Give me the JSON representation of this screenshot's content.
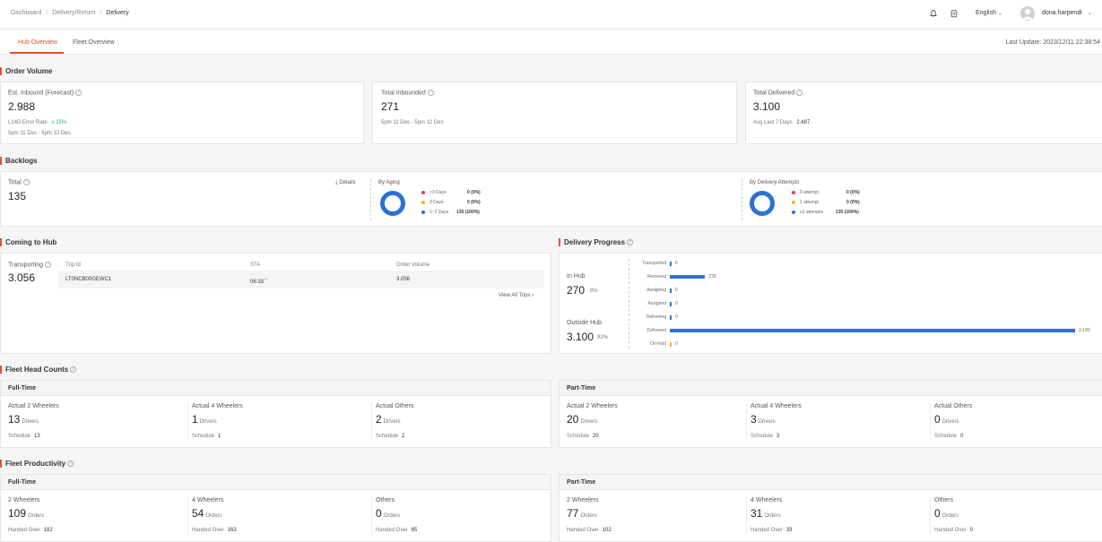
{
  "breadcrumb": {
    "items": [
      "Dashboard",
      "Delivery/Return",
      "Delivery"
    ]
  },
  "header": {
    "language": "English",
    "username": "dona.harpendi"
  },
  "tabs": [
    {
      "label": "Hub Overview",
      "active": true
    },
    {
      "label": "Fleet Overview",
      "active": false
    }
  ],
  "last_update": "Last Update: 2023/12/11 22:38:54",
  "order_volume": {
    "title": "Order Volume",
    "inbound_forecast": {
      "label": "Est. Inbound (Forecast)",
      "value": "2.988",
      "error_label": "L14D Error Rate",
      "error_value": "≤ 15%",
      "range": "5pm 11 Des - 5pm 12 Des"
    },
    "total_inbounded": {
      "label": "Total Inbounded",
      "value": "271",
      "range": "5pm 11 Des - 5pm 12 Des"
    },
    "total_delivered": {
      "label": "Total Delivered",
      "value": "3.100",
      "avg_label": "Avg Last 7 Days",
      "avg_value": "2.487"
    }
  },
  "backlogs": {
    "title": "Backlogs",
    "total_label": "Total",
    "total_value": "135",
    "details_label": "Details",
    "aging": {
      "title": "By Aging",
      "items": [
        {
          "label": ">3 Days",
          "value": "0 (0%)",
          "color": "#e8384f"
        },
        {
          "label": "3 Days",
          "value": "0 (0%)",
          "color": "#f5b31a"
        },
        {
          "label": "1~2 Days",
          "value": "135 (100%)",
          "color": "#2b72d6"
        }
      ]
    },
    "attempts": {
      "title": "By Delivery Attempts",
      "items": [
        {
          "label": "0 attempt",
          "value": "0 (0%)",
          "color": "#e8384f"
        },
        {
          "label": "1 attempt",
          "value": "0 (0%)",
          "color": "#f5b31a"
        },
        {
          "label": "≥2 attempts",
          "value": "135 (100%)",
          "color": "#2b72d6"
        }
      ]
    }
  },
  "coming_to_hub": {
    "title": "Coming to Hub",
    "transporting_label": "Transporting",
    "transporting_value": "3.056",
    "columns": [
      "Trip Id",
      "STA",
      "Order Volume"
    ],
    "row": {
      "trip_id": "LT0NCB00GEWC1",
      "sta": "06:33",
      "sta_suffix": "+1",
      "volume": "3.056"
    },
    "view_all": "View All Trips"
  },
  "delivery_progress": {
    "title": "Delivery Progress",
    "in_hub_label": "In Hub",
    "in_hub_value": "270",
    "in_hub_pct": "8%",
    "outside_hub_label": "Outside Hub",
    "outside_hub_value": "3.100",
    "outside_hub_pct": "92%",
    "stages": [
      {
        "label": "Transported",
        "value": "0",
        "fraction": 0,
        "color": "#2b72d6"
      },
      {
        "label": "Received",
        "value": "270",
        "fraction": 0.087,
        "color": "#2b72d6"
      },
      {
        "label": "Assigning",
        "value": "0",
        "fraction": 0,
        "color": "#2b72d6"
      },
      {
        "label": "Assigned",
        "value": "0",
        "fraction": 0,
        "color": "#2b72d6"
      },
      {
        "label": "Delivering",
        "value": "0",
        "fraction": 0,
        "color": "#2b72d6"
      },
      {
        "label": "Delivered",
        "value": "3.100",
        "fraction": 1,
        "color": "#2b72d6"
      },
      {
        "label": "On-hold",
        "value": "0",
        "fraction": 0,
        "color": "#f5b31a"
      }
    ]
  },
  "fleet_head_counts": {
    "title": "Fleet Head Counts",
    "groups": [
      {
        "name": "Full-Time",
        "items": [
          {
            "label": "Actual 2 Wheelers",
            "value": "13",
            "unit": "Drivers",
            "sub_label": "Schedule",
            "sub_value": "13"
          },
          {
            "label": "Actual 4 Wheelers",
            "value": "1",
            "unit": "Drivers",
            "sub_label": "Schedule",
            "sub_value": "1"
          },
          {
            "label": "Actual Others",
            "value": "2",
            "unit": "Drivers",
            "sub_label": "Schedule",
            "sub_value": "2"
          }
        ]
      },
      {
        "name": "Part-Time",
        "items": [
          {
            "label": "Actual 2 Wheelers",
            "value": "20",
            "unit": "Drivers",
            "sub_label": "Schedule",
            "sub_value": "20"
          },
          {
            "label": "Actual 4 Wheelers",
            "value": "3",
            "unit": "Drivers",
            "sub_label": "Schedule",
            "sub_value": "3"
          },
          {
            "label": "Actual Others",
            "value": "0",
            "unit": "Drivers",
            "sub_label": "Schedule",
            "sub_value": "0"
          }
        ]
      }
    ]
  },
  "fleet_productivity": {
    "title": "Fleet Productivity",
    "groups": [
      {
        "name": "Full-Time",
        "items": [
          {
            "label": "2 Wheelers",
            "value": "109",
            "unit": "Orders",
            "sub_label": "Handed Over",
            "sub_value": "182"
          },
          {
            "label": "4 Wheelers",
            "value": "54",
            "unit": "Orders",
            "sub_label": "Handed Over",
            "sub_value": "163"
          },
          {
            "label": "Others",
            "value": "0",
            "unit": "Orders",
            "sub_label": "Handed Over",
            "sub_value": "65"
          }
        ]
      },
      {
        "name": "Part-Time",
        "items": [
          {
            "label": "2 Wheelers",
            "value": "77",
            "unit": "Orders",
            "sub_label": "Handed Over",
            "sub_value": "102"
          },
          {
            "label": "4 Wheelers",
            "value": "31",
            "unit": "Orders",
            "sub_label": "Handed Over",
            "sub_value": "33"
          },
          {
            "label": "Others",
            "value": "0",
            "unit": "Orders",
            "sub_label": "Handed Over",
            "sub_value": "0"
          }
        ]
      }
    ]
  }
}
